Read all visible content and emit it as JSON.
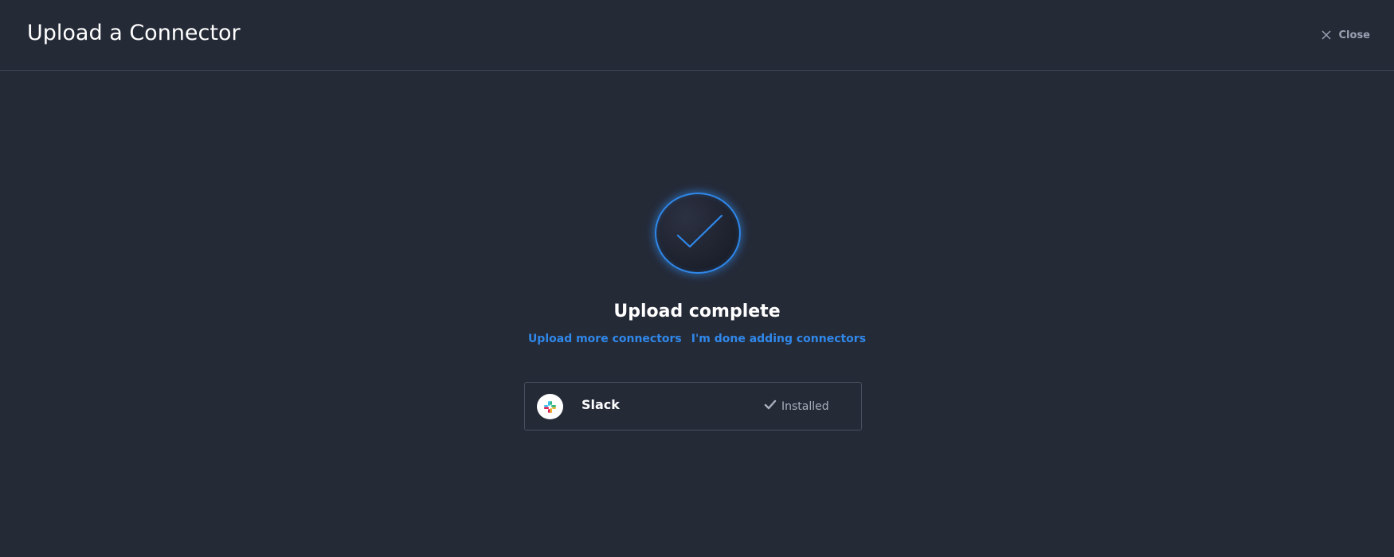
{
  "header": {
    "title": "Upload a Connector",
    "close_label": "Close",
    "close_icon": "close-icon"
  },
  "result": {
    "icon": "checkmark-icon",
    "title": "Upload complete",
    "links": {
      "upload_more": "Upload more connectors",
      "done": "I'm done adding connectors"
    }
  },
  "connector": {
    "logo_icon": "slack-logo-icon",
    "name": "Slack",
    "status_icon": "check-icon",
    "status": "Installed"
  },
  "colors": {
    "background": "#252a37",
    "accent": "#2f88ea",
    "divider": "#3a4050",
    "muted_text": "#a9afbd"
  }
}
